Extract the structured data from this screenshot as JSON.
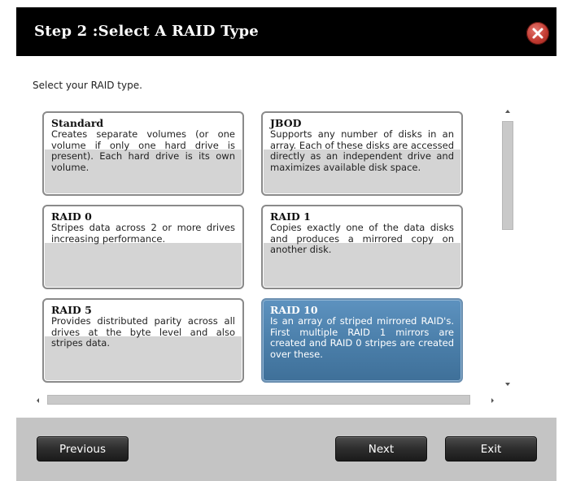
{
  "window": {
    "title": "Step 2 :Select A RAID Type",
    "close_icon": "close-icon"
  },
  "instruction": "Select your RAID type.",
  "raid_options": [
    {
      "title": "Standard",
      "description": "Creates separate volumes (or one volume if only one hard drive is present). Each hard drive is its own volume.",
      "selected": false
    },
    {
      "title": "JBOD",
      "description": "Supports any number of disks in an array. Each of these disks are accessed directly as an independent drive and maximizes available disk space.",
      "selected": false
    },
    {
      "title": "RAID 0",
      "description": "Stripes data across 2 or more drives increasing performance.",
      "selected": false
    },
    {
      "title": "RAID 1",
      "description": "Copies exactly one of the data disks and produces a mirrored copy on another disk.",
      "selected": false
    },
    {
      "title": "RAID 5",
      "description": "Provides distributed parity across all drives at the byte level and also stripes data.",
      "selected": false
    },
    {
      "title": "RAID 10",
      "description": "Is an array of striped mirrored RAID's. First multiple RAID 1 mirrors are created and RAID 0 stripes are created over these.",
      "selected": true
    }
  ],
  "buttons": {
    "previous": "Previous",
    "next": "Next",
    "exit": "Exit"
  },
  "colors": {
    "titlebar": "#000000",
    "selected_card": "#4a7ea9",
    "footer": "#c4c4c4",
    "close": "#c23a31"
  }
}
